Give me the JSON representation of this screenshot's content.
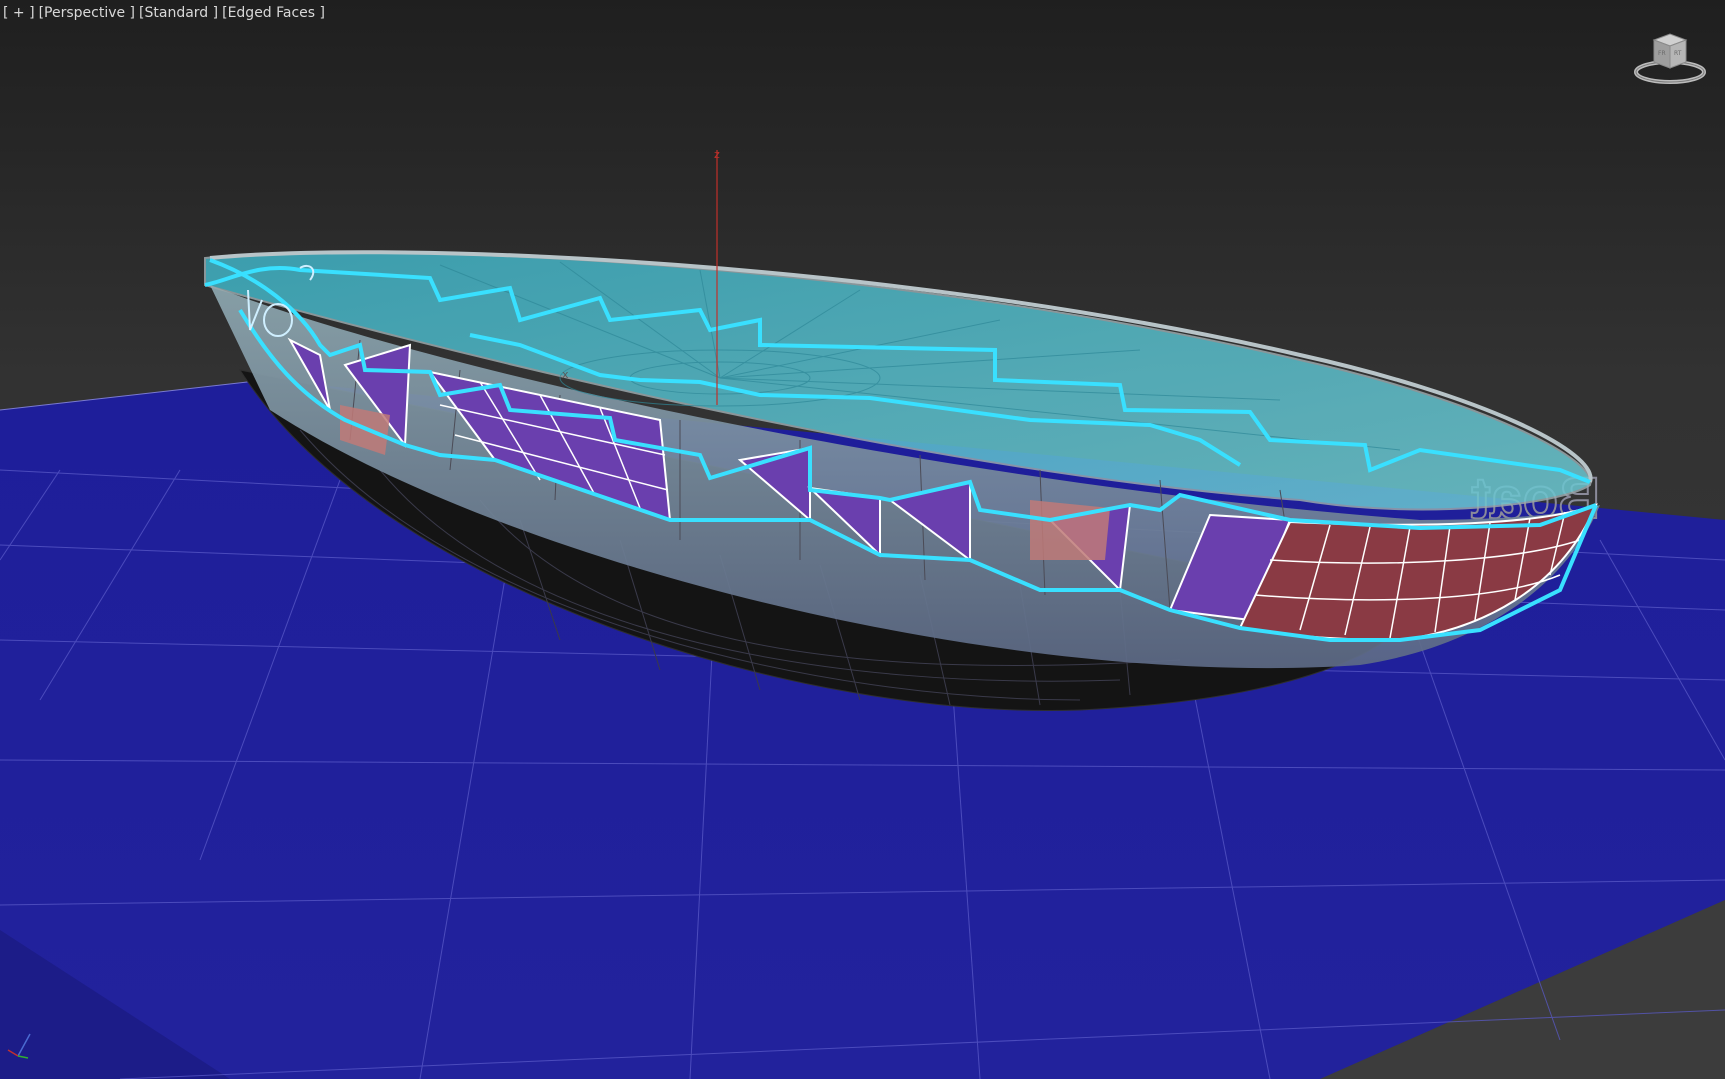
{
  "viewport": {
    "label_menu": "[ + ]",
    "label_view": "[Perspective ]",
    "label_shading": "[Standard ]",
    "label_faces": "[Edged Faces ]"
  },
  "scene": {
    "object_name": "3ds Max perspective viewport showing boat hull model with cyan selection outline over blue ground plane",
    "gizmo_axis_label": "z",
    "background_text": "Boat",
    "colors": {
      "ground": "#20209a",
      "selection": "#39e0ff",
      "hull_panel_purple": "#6a3fae",
      "hull_panel_red": "#8a3a44",
      "deck_cyan": "#4fb8c8"
    }
  },
  "icons": {
    "viewcube": "viewcube-icon",
    "axis_tripod": "axis-tripod-icon"
  }
}
